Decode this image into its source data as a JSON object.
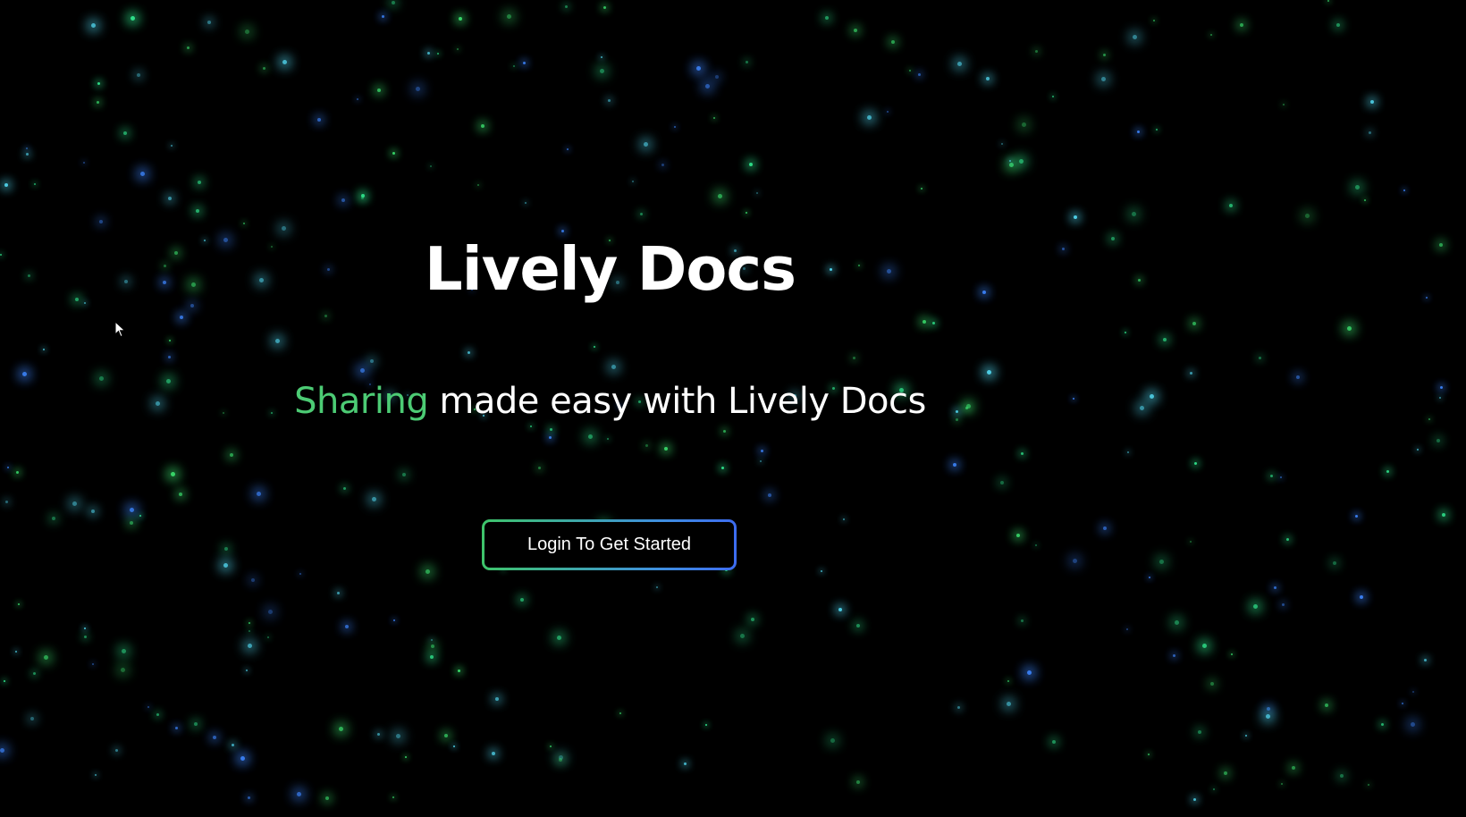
{
  "hero": {
    "title": "Lively Docs",
    "subtitle_accent": "Sharing",
    "subtitle_rest": " made easy with Lively Docs",
    "cta_label": "Login To Get Started"
  },
  "theme": {
    "background": "#000000",
    "text": "#ffffff",
    "accent_green": "#4ccb74",
    "gradient_start": "#3ec46a",
    "gradient_end": "#3d6cf0",
    "particle_colors": [
      "#39d86a",
      "#4fd0e8",
      "#3a7ef0",
      "#2fe08a"
    ]
  },
  "icons": {
    "cursor": "arrow-pointer-icon"
  }
}
